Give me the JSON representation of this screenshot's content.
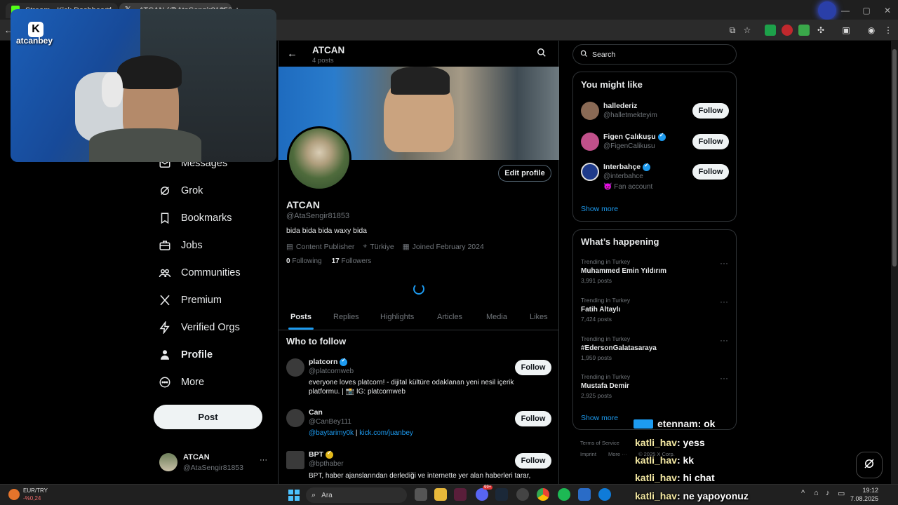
{
  "browser": {
    "tabs": [
      {
        "label": "Stream - Kick Dashboard"
      },
      {
        "label": "ATCAN (@AtaSengir81853) / X"
      }
    ],
    "new_tab_label": "+",
    "window_controls": {
      "minimize": "—",
      "maximize": "▢",
      "close": "✕"
    }
  },
  "webcam": {
    "brand_logo": "K",
    "channel_name": "atcanbey"
  },
  "nav": {
    "items": [
      {
        "label": "Messages",
        "icon": "mail-icon"
      },
      {
        "label": "Grok",
        "icon": "grok-icon"
      },
      {
        "label": "Bookmarks",
        "icon": "bookmark-icon"
      },
      {
        "label": "Jobs",
        "icon": "briefcase-icon"
      },
      {
        "label": "Communities",
        "icon": "people-icon"
      },
      {
        "label": "Premium",
        "icon": "x-logo-icon"
      },
      {
        "label": "Verified Orgs",
        "icon": "lightning-icon"
      },
      {
        "label": "Profile",
        "icon": "person-icon"
      },
      {
        "label": "More",
        "icon": "more-circle-icon"
      }
    ],
    "post_button": "Post",
    "account": {
      "name": "ATCAN",
      "handle": "@AtaSengir81853",
      "menu": "···"
    }
  },
  "profile": {
    "header_name": "ATCAN",
    "post_count": "4 posts",
    "display_name": "ATCAN",
    "handle": "@AtaSengir81853",
    "bio": "bida bida bida waxy bida",
    "category": "Content Publisher",
    "location": "Türkiye",
    "joined": "Joined February 2024",
    "following_count": "0",
    "following_label": "Following",
    "followers_count": "17",
    "followers_label": "Followers",
    "edit_button": "Edit profile",
    "tabs": [
      "Posts",
      "Replies",
      "Highlights",
      "Articles",
      "Media",
      "Likes"
    ],
    "active_tab": "Posts"
  },
  "who_to_follow": {
    "title": "Who to follow",
    "accounts": [
      {
        "name": "platcorn",
        "handle": "@platcornweb",
        "verified": "blue",
        "bio": "everyone loves platcorn! - dijital kültüre odaklanan yeni nesil içerik platformu. | 📸 IG: platcornweb",
        "button": "Follow"
      },
      {
        "name": "Can",
        "handle": "@CanBey111",
        "bio_link1": "@baytarimy0k",
        "bio_sep": " | ",
        "bio_link2": "kick.com/juanbey",
        "button": "Follow"
      },
      {
        "name": "BPT",
        "handle": "@bpthaber",
        "verified": "gold",
        "bio": "BPT, haber ajanslarından derlediği ve internette yer alan haberleri tarar,",
        "button": "Follow"
      }
    ]
  },
  "search": {
    "placeholder": "Search"
  },
  "you_might_like": {
    "title": "You might like",
    "accounts": [
      {
        "name": "hallederiz",
        "handle": "@halletmekteyim",
        "button": "Follow"
      },
      {
        "name": "Figen Çalıkuşu",
        "handle": "@FigenCalikusu",
        "verified": "blue",
        "button": "Follow"
      },
      {
        "name": "Interbahçe",
        "handle": "@interbahce",
        "verified": "blue",
        "note": "😈 Fan account",
        "button": "Follow"
      }
    ],
    "show_more": "Show more"
  },
  "whats_happening": {
    "title": "What’s happening",
    "trends": [
      {
        "context": "Trending in Turkey",
        "name": "Muhammed Emin Yıldırım",
        "posts": "3,991 posts"
      },
      {
        "context": "Trending in Turkey",
        "name": "Fatih Altaylı",
        "posts": "7,424 posts"
      },
      {
        "context": "Trending in Turkey",
        "name": "#EdersonGalatasaraya",
        "posts": "1,959 posts"
      },
      {
        "context": "Trending in Turkey",
        "name": "Mustafa Demir",
        "posts": "2,925 posts"
      }
    ],
    "show_more": "Show more",
    "more_menu": "···"
  },
  "footer": {
    "terms": "Terms of Service",
    "imprint": "Imprint",
    "more": "More ···",
    "copyright": "© 2025 X Corp."
  },
  "chat": [
    {
      "user": "etennam",
      "message": ": ok"
    },
    {
      "user": "katli_hav",
      "message": ": yess"
    },
    {
      "user": "katli_hav",
      "message": ": kk"
    },
    {
      "user": "katli_hav",
      "message": ": hi chat"
    },
    {
      "user": "katli_hav",
      "message": ": ne yapoyonuz"
    }
  ],
  "taskbar": {
    "ticker": {
      "pair": "EUR/TRY",
      "change": "-%0,24"
    },
    "search_placeholder": "Ara",
    "time": "19:12",
    "date": "7.08.2025",
    "badge": "99+"
  },
  "colors": {
    "accent": "#1d9bf0",
    "kick_green": "#53fc18",
    "chat_name": "#f4e9a3"
  }
}
